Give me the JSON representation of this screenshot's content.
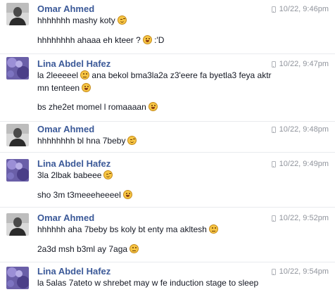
{
  "messages": [
    {
      "sender": "Omar Ahmed",
      "avatar": "omar-avatar",
      "time": "10/22, 9:46pm",
      "lines": [
        {
          "text": "hhhhhhh mashy koty",
          "emoji": "wink-emoji"
        },
        {
          "text": "hhhhhhhh ahaaa eh kteer ?",
          "emoji": "grin-emoji",
          "suffix": " :'D"
        }
      ]
    },
    {
      "sender": "Lina Abdel Hafez",
      "avatar": "lina-avatar",
      "time": "10/22, 9:47pm",
      "lines": [
        {
          "text": "la 2leeeeel",
          "emoji": "neutral-emoji",
          "suffix": " ana bekol bma3la2a z3'eere fa byetla3 feya aktr"
        },
        {
          "text": "mn tenteen",
          "emoji": "grin-emoji"
        },
        {
          "text": "bs zhe2et momel l romaaaan",
          "emoji": "grin-emoji"
        }
      ]
    },
    {
      "sender": "Omar Ahmed",
      "avatar": "omar-avatar",
      "time": "10/22, 9:48pm",
      "lines": [
        {
          "text": "hhhhhhhh bl hna 7beby",
          "emoji": "wink-emoji"
        }
      ]
    },
    {
      "sender": "Lina Abdel Hafez",
      "avatar": "lina-avatar",
      "time": "10/22, 9:49pm",
      "lines": [
        {
          "text": "3la 2lbak babeee",
          "emoji": "wink-emoji"
        },
        {
          "text": "sho 3m t3meeeheeeel",
          "emoji": "grin-emoji"
        }
      ]
    },
    {
      "sender": "Omar Ahmed",
      "avatar": "omar-avatar",
      "time": "10/22, 9:52pm",
      "lines": [
        {
          "text": "hhhhhh aha 7beby bs koly bt enty ma akltesh",
          "emoji": "neutral-emoji"
        },
        {
          "text": "2a3d msh b3ml ay 7aga",
          "emoji": "neutral-emoji"
        }
      ]
    },
    {
      "sender": "Lina Abdel Hafez",
      "avatar": "lina-avatar",
      "time": "10/22, 9:54pm",
      "lines": [
        {
          "text": "la 5alas 7ateto w shrebet may w fe induction stage to sleep"
        }
      ]
    }
  ],
  "colors": {
    "sender_name": "#3b5998",
    "timestamp": "#90949c",
    "separator": "#e9ebee",
    "text": "#141823"
  }
}
